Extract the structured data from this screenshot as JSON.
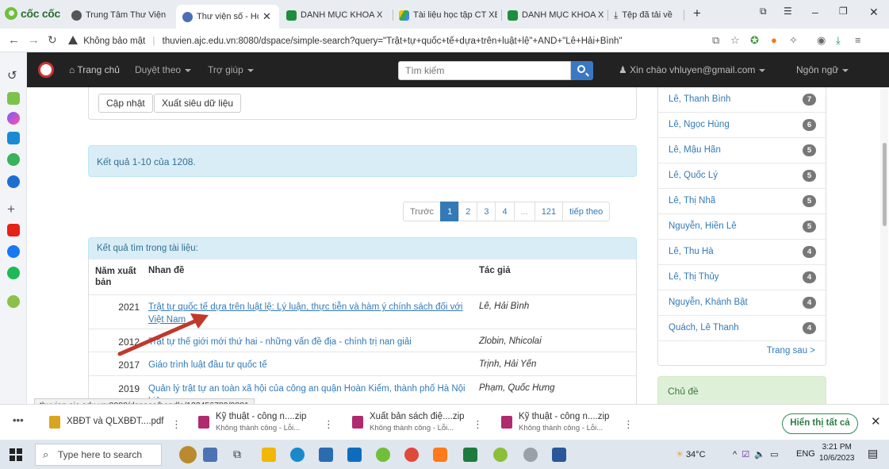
{
  "browser": {
    "brand": "cốc cốc",
    "tabs": [
      {
        "label": "Trung Tâm Thư Viện"
      },
      {
        "label": "Thư viện số - Họ"
      },
      {
        "label": "DANH MỤC KHOA X"
      },
      {
        "label": "Tài liệu học tập CT XE"
      },
      {
        "label": "DANH MỤC KHOA X"
      },
      {
        "label": "Tệp đã tải về"
      }
    ],
    "new_tab": "+",
    "security_label": "Không bảo mật",
    "url": "thuvien.ajc.edu.vn:8080/dspace/simple-search?query=\"Trật+tự+quốc+tế+dựa+trên+luật+lệ\"+AND+\"Lê+Hải+Bình\""
  },
  "site": {
    "nav": {
      "home": "Trang chủ",
      "browse": "Duyệt theo",
      "help": "Trợ giúp",
      "search_placeholder": "Tìm kiếm",
      "user": "Xin chào vhluyen@gmail.com",
      "language": "Ngôn ngữ"
    },
    "actions": {
      "update": "Cập nhật",
      "export": "Xuất siêu dữ liệu"
    },
    "result_count": "Kết quả 1-10 của 1208.",
    "pagination": {
      "prev": "Trước",
      "pages": [
        "1",
        "2",
        "3",
        "4",
        "...",
        "121"
      ],
      "next": "tiếp theo",
      "active": "1"
    },
    "results": {
      "heading": "Kết quả tìm trong tài liệu:",
      "columns": {
        "year": "Năm xuất bản",
        "title": "Nhan đề",
        "author": "Tác giả"
      },
      "rows": [
        {
          "year": "2021",
          "title": "Trật tự quốc tế dựa trên luật lệ: Lý luận, thực tiễn và hàm ý chính sách đối với Việt Nam",
          "author": "Lê, Hải Bình"
        },
        {
          "year": "2012",
          "title": "Trật tự thế giới mới thứ hai - những vấn đề địa - chính trị nan giải",
          "author": "Zlobin, Nhicolai"
        },
        {
          "year": "2017",
          "title": "Giáo trình luật đầu tư quốc tế",
          "author": "Trịnh, Hải Yến"
        },
        {
          "year": "2019",
          "title": "Quản lý trật tự an toàn xã hội của công an quận Hoàn Kiếm, thành phố Hà Nội hiện nay",
          "author": "Phạm, Quốc Hưng"
        }
      ]
    },
    "authors": [
      {
        "name": "Lê, Thanh Bình",
        "count": "7"
      },
      {
        "name": "Lê, Ngọc Hùng",
        "count": "6"
      },
      {
        "name": "Lê, Mậu Hãn",
        "count": "5"
      },
      {
        "name": "Lê, Quốc Lý",
        "count": "5"
      },
      {
        "name": "Lê, Thị Nhã",
        "count": "5"
      },
      {
        "name": "Nguyễn, Hiền Lê",
        "count": "5"
      },
      {
        "name": "Lê, Thu Hà",
        "count": "4"
      },
      {
        "name": "Lê, Thị Thủy",
        "count": "4"
      },
      {
        "name": "Nguyễn, Khánh Bật",
        "count": "4"
      },
      {
        "name": "Quách, Lê Thanh",
        "count": "4"
      }
    ],
    "authors_next": "Trang sau >",
    "subject_heading": "Chủ đề",
    "status_url": "thuvien.ajc.edu.vn:8080/dspace/handle/123456789/9881"
  },
  "downloads": {
    "items": [
      {
        "name": "XBĐT và QLXBĐT....pdf",
        "sub": "",
        "color": "#d9a520"
      },
      {
        "name": "Kỹ thuật - công n....zip",
        "sub": "Không thành công - Lỗi...",
        "color": "#b02a6f"
      },
      {
        "name": "Xuất bản sách điệ....zip",
        "sub": "Không thành công - Lỗi...",
        "color": "#b02a6f"
      },
      {
        "name": "Kỹ thuật - công n....zip",
        "sub": "Không thành công - Lỗi...",
        "color": "#b02a6f"
      }
    ],
    "show_all": "Hiển thị tất cả"
  },
  "taskbar": {
    "search_placeholder": "Type here to search",
    "temperature": "34°C",
    "language": "ENG",
    "time": "3:21 PM",
    "date": "10/6/2023"
  },
  "colors": {
    "accent": "#337ab7",
    "arrow": "#c0392b",
    "navbar": "#222222"
  }
}
